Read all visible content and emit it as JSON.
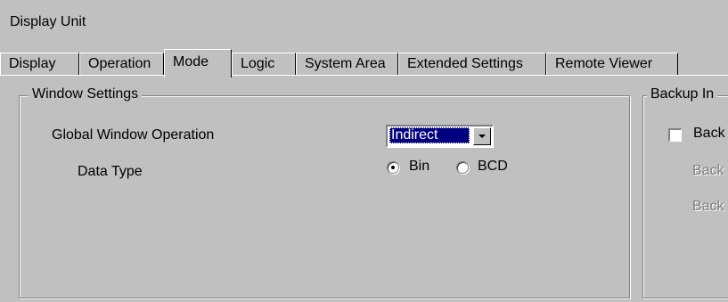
{
  "window": {
    "title": "Display Unit"
  },
  "tabs": [
    {
      "label": "Display"
    },
    {
      "label": "Operation"
    },
    {
      "label": "Mode",
      "active": true
    },
    {
      "label": "Logic"
    },
    {
      "label": "System Area"
    },
    {
      "label": "Extended Settings"
    },
    {
      "label": "Remote Viewer"
    }
  ],
  "window_settings": {
    "title": "Window Settings",
    "global_label": "Global Window Operation",
    "global_value": "Indirect",
    "data_type_label": "Data Type",
    "radio_bin": {
      "label": "Bin",
      "checked": true
    },
    "radio_bcd": {
      "label": "BCD",
      "checked": false
    }
  },
  "backup": {
    "title": "Backup In",
    "checkbox_label": "Back",
    "line1": "Back",
    "line2": "Back"
  }
}
